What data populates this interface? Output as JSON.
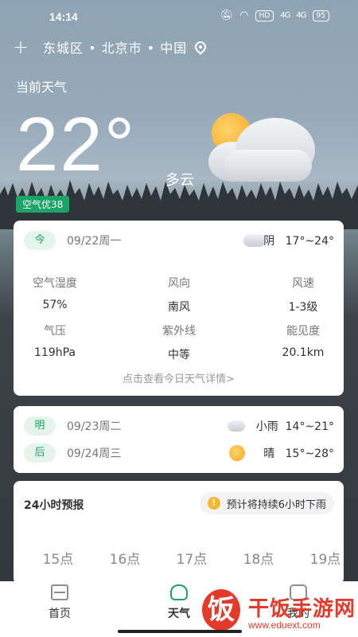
{
  "status_bar": {
    "time": "14:14",
    "network_badge": "HD",
    "signal1": "4G",
    "signal2": "4G",
    "battery": "95"
  },
  "location_bar": {
    "add_icon": "plus-icon",
    "location": "东城区 • 北京市 • 中国",
    "location_icon": "location-pin-icon"
  },
  "current": {
    "label": "当前天气",
    "temperature": "22°",
    "condition": "多云",
    "aqi": "空气优38",
    "weather_icon": "partly-cloudy-icon"
  },
  "today_card": {
    "day_label": "今",
    "date": "09/22周一",
    "weather_icon": "cloud-icon",
    "condition": "阴",
    "temp_range": "17°~24°",
    "details": [
      {
        "label": "空气湿度",
        "value": "57%"
      },
      {
        "label": "风向",
        "value": "南风"
      },
      {
        "label": "风速",
        "value": "1-3级"
      },
      {
        "label": "气压",
        "value": "119hPa"
      },
      {
        "label": "紫外线",
        "value": "中等"
      },
      {
        "label": "能见度",
        "value": "20.1km"
      }
    ],
    "detail_link": "点击查看今日天气详情>"
  },
  "forecast": [
    {
      "day_label": "明",
      "date": "09/23周二",
      "weather_icon": "light-rain-icon",
      "condition": "小雨",
      "temp_range": "14°~21°"
    },
    {
      "day_label": "后",
      "date": "09/24周三",
      "weather_icon": "sun-icon",
      "condition": "晴",
      "temp_range": "15°~28°"
    }
  ],
  "hourly": {
    "title": "24小时预报",
    "alert": "预计将持续6小时下雨",
    "alert_icon": "warning-icon",
    "hours": [
      "15点",
      "16点",
      "17点",
      "18点",
      "19点"
    ]
  },
  "tabbar": {
    "tabs": [
      {
        "label": "首页",
        "icon": "home-icon"
      },
      {
        "label": "天气",
        "icon": "weather-icon",
        "active": true
      },
      {
        "label": "我的",
        "icon": "face-icon"
      }
    ]
  },
  "watermark": {
    "logo_char": "饭",
    "text": "干饭手游网",
    "url": "www.eduext.com"
  },
  "colors": {
    "accent": "#1aa467",
    "sun": "#f3a722"
  }
}
